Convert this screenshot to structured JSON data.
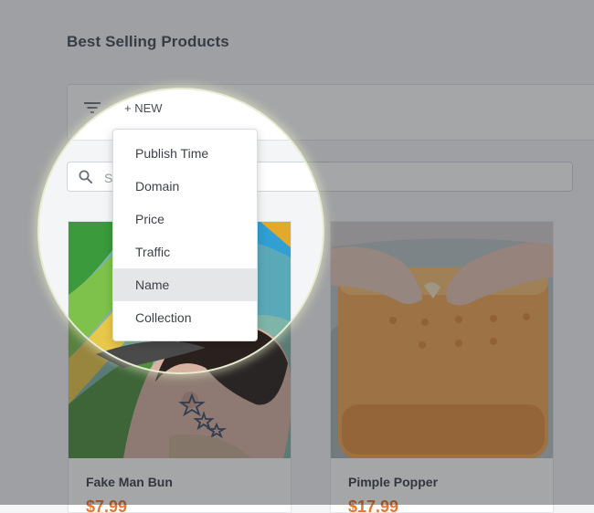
{
  "page": {
    "title": "Best Selling Products"
  },
  "toolbar": {
    "new_label": "+ NEW"
  },
  "search": {
    "placeholder": "Search"
  },
  "sort_menu": {
    "items": [
      {
        "label": "Publish Time"
      },
      {
        "label": "Domain"
      },
      {
        "label": "Price"
      },
      {
        "label": "Traffic"
      },
      {
        "label": "Name",
        "selected": true
      },
      {
        "label": "Collection"
      }
    ]
  },
  "products": [
    {
      "name": "Fake Man Bun",
      "price": "$7.99"
    },
    {
      "name": "Pimple Popper",
      "price": "$17.99"
    }
  ],
  "colors": {
    "price": "#e8752c",
    "selected_item_bg": "#e5e6e8"
  }
}
